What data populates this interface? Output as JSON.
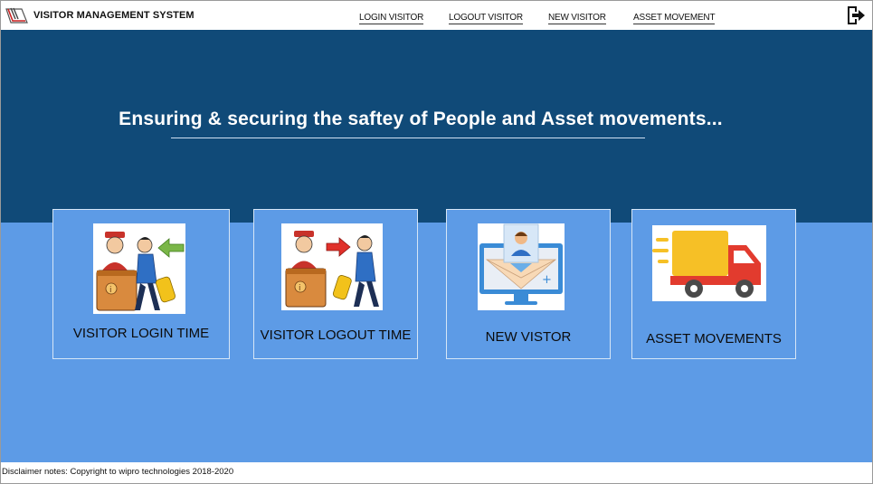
{
  "app": {
    "title": "VISITOR MANAGEMENT SYSTEM"
  },
  "nav": {
    "items": [
      {
        "label": "LOGIN VISITOR"
      },
      {
        "label": "LOGOUT VISITOR"
      },
      {
        "label": "NEW VISITOR"
      },
      {
        "label": "ASSET MOVEMENT"
      }
    ]
  },
  "hero": {
    "tagline": "Ensuring & securing the saftey of People and Asset movements..."
  },
  "cards": [
    {
      "label": "VISITOR LOGIN TIME",
      "icon": "visitor-login-icon"
    },
    {
      "label": "VISITOR LOGOUT TIME",
      "icon": "visitor-logout-icon"
    },
    {
      "label": "NEW VISTOR",
      "icon": "new-visitor-icon"
    },
    {
      "label": "ASSET MOVEMENTS",
      "icon": "delivery-truck-icon"
    }
  ],
  "footer": {
    "text": "Disclaimer notes: Copyright to wipro technologies 2018-2020"
  },
  "colors": {
    "header_blue": "#104a78",
    "panel_blue": "#5d9be6",
    "arrow_green": "#7ab648",
    "arrow_red": "#e0302a",
    "truck_red": "#e23b2e",
    "truck_yellow": "#f6c026"
  }
}
